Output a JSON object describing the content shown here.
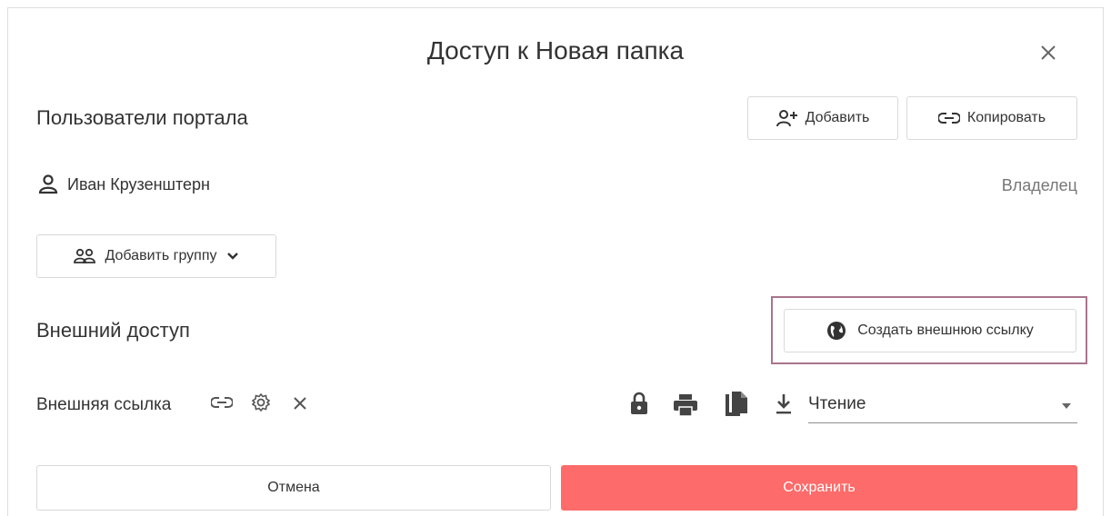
{
  "dialog": {
    "title": "Доступ к Новая папка",
    "close_icon": "close-icon"
  },
  "portal_users": {
    "heading": "Пользователи портала",
    "add_button_label": "Добавить",
    "copy_button_label": "Копировать",
    "user": {
      "name": "Иван Крузенштерн",
      "role": "Владелец"
    },
    "add_group_label": "Добавить группу"
  },
  "external_access": {
    "heading": "Внешний доступ",
    "create_link_label": "Создать внешнюю ссылку",
    "link_label": "Внешняя ссылка",
    "permission_value": "Чтение",
    "icons": [
      "link-icon",
      "gear-icon",
      "close-icon",
      "lock-icon",
      "print-icon",
      "copy-icon",
      "download-icon"
    ]
  },
  "footer": {
    "cancel_label": "Отмена",
    "save_label": "Сохранить"
  },
  "colors": {
    "accent": "#fd6b6a",
    "highlight_border": "#a8758c",
    "border": "#d9d9d9",
    "text": "#333333",
    "muted": "#777777"
  }
}
